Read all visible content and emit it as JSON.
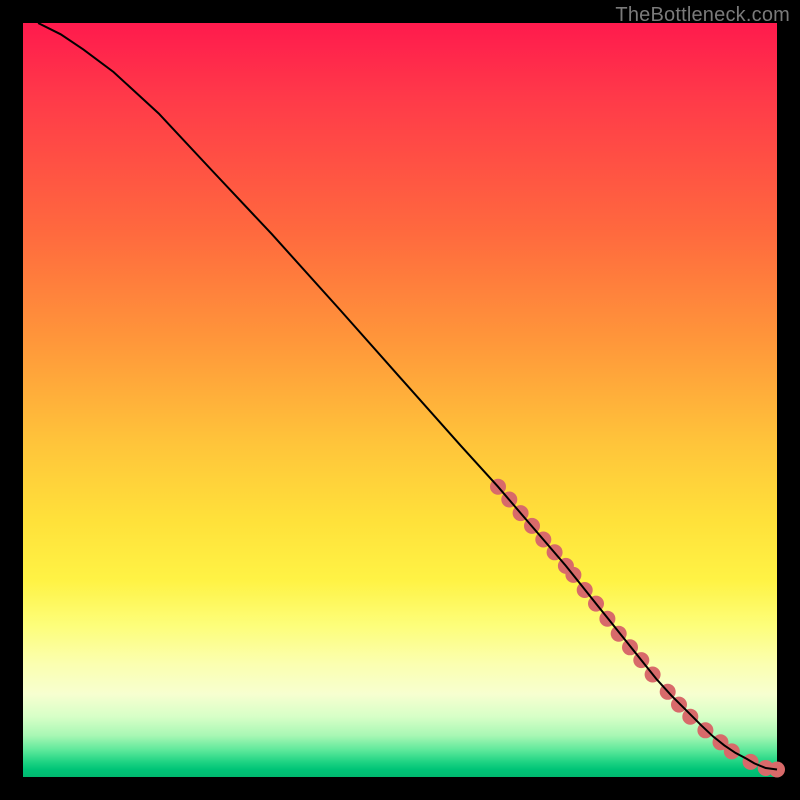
{
  "watermark": "TheBottleneck.com",
  "chart_data": {
    "type": "line",
    "title": "",
    "xlabel": "",
    "ylabel": "",
    "xlim": [
      0,
      100
    ],
    "ylim": [
      0,
      100
    ],
    "grid": false,
    "series": [
      {
        "name": "curve",
        "x": [
          2,
          5,
          8,
          12,
          18,
          25,
          33,
          42,
          50,
          58,
          63,
          66,
          69,
          72,
          74,
          76,
          78,
          80,
          82,
          84,
          86,
          88,
          90,
          91.5,
          93,
          94.5,
          96,
          97,
          98.5,
          100
        ],
        "y": [
          100,
          98.5,
          96.5,
          93.5,
          88,
          80.5,
          72,
          62,
          53,
          44,
          38.5,
          35,
          31.5,
          28,
          25.5,
          23,
          20.5,
          18,
          15.5,
          13,
          10.8,
          8.8,
          6.8,
          5.4,
          4.2,
          3.2,
          2.4,
          1.8,
          1.2,
          1
        ],
        "color": "#000000",
        "width": 2
      }
    ],
    "markers": [
      {
        "name": "highlight-dots",
        "color": "#d86a6a",
        "radius": 8,
        "points": [
          {
            "x": 63,
            "y": 38.5
          },
          {
            "x": 64.5,
            "y": 36.8
          },
          {
            "x": 66,
            "y": 35
          },
          {
            "x": 67.5,
            "y": 33.3
          },
          {
            "x": 69,
            "y": 31.5
          },
          {
            "x": 70.5,
            "y": 29.8
          },
          {
            "x": 72,
            "y": 28
          },
          {
            "x": 73,
            "y": 26.8
          },
          {
            "x": 74.5,
            "y": 24.8
          },
          {
            "x": 76,
            "y": 23
          },
          {
            "x": 77.5,
            "y": 21
          },
          {
            "x": 79,
            "y": 19
          },
          {
            "x": 80.5,
            "y": 17.2
          },
          {
            "x": 82,
            "y": 15.5
          },
          {
            "x": 83.5,
            "y": 13.6
          },
          {
            "x": 85.5,
            "y": 11.3
          },
          {
            "x": 87,
            "y": 9.6
          },
          {
            "x": 88.5,
            "y": 8
          },
          {
            "x": 90.5,
            "y": 6.2
          },
          {
            "x": 92.5,
            "y": 4.6
          },
          {
            "x": 94,
            "y": 3.4
          },
          {
            "x": 96.5,
            "y": 2
          },
          {
            "x": 98.5,
            "y": 1.2
          },
          {
            "x": 100,
            "y": 1
          }
        ]
      }
    ]
  }
}
